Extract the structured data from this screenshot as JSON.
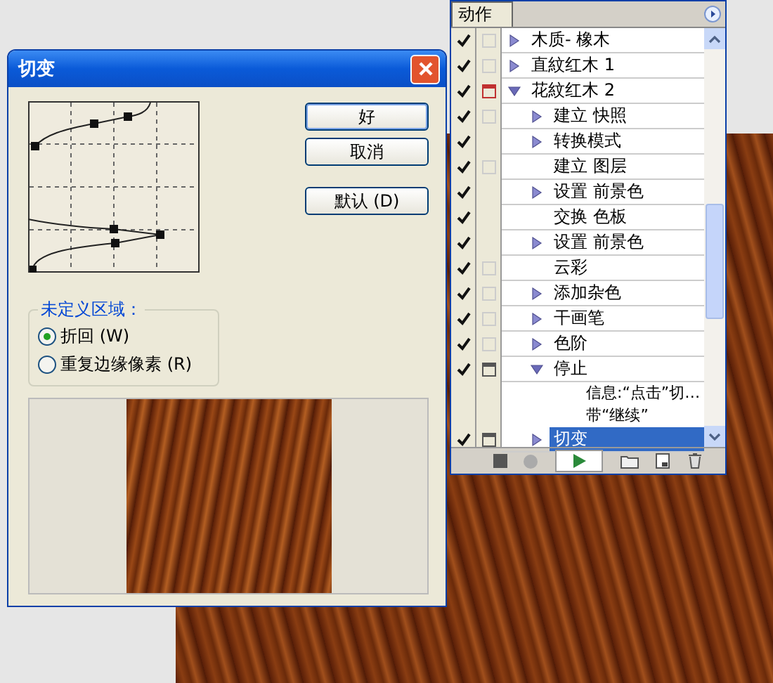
{
  "dialog": {
    "title": "切变",
    "buttons": [
      {
        "label": "好",
        "default": true
      },
      {
        "label": "取消",
        "default": false
      },
      {
        "label": "默认 (D)",
        "default": false
      }
    ],
    "undefined_area": {
      "title": "未定义区域：",
      "options": [
        {
          "label": "折回 (W)",
          "selected": true
        },
        {
          "label": "重复边缘像素 (R)",
          "selected": false
        }
      ]
    }
  },
  "actions_panel": {
    "tab": "动作",
    "items": [
      {
        "label": "木质- 橡木",
        "checked": true,
        "dialog_on": false,
        "dialog_partial": false,
        "expanded": false,
        "selected": false
      },
      {
        "label": "直紋红木 1",
        "checked": true,
        "dialog_on": false,
        "dialog_partial": false,
        "expanded": false,
        "selected": false
      },
      {
        "label": "花紋红木 2",
        "checked": true,
        "dialog_on": false,
        "dialog_partial": true,
        "expanded": true,
        "selected": false,
        "children": [
          {
            "label": "建立 快照",
            "checked": true,
            "dialog_on": false,
            "dialog_partial": false,
            "expanded": false,
            "selected": false
          },
          {
            "label": "转换模式",
            "checked": true,
            "expanded": false,
            "selected": false
          },
          {
            "label": "建立 图层",
            "checked": true,
            "dialog_on": false,
            "dialog_partial": false,
            "selected": false
          },
          {
            "label": "设置 前景色",
            "checked": true,
            "expanded": false,
            "selected": false
          },
          {
            "label": "交换 色板",
            "checked": true,
            "selected": false
          },
          {
            "label": "设置 前景色",
            "checked": true,
            "expanded": false,
            "selected": false
          },
          {
            "label": "云彩",
            "checked": true,
            "dialog_on": false,
            "dialog_partial": false,
            "selected": false
          },
          {
            "label": "添加杂色",
            "checked": true,
            "dialog_on": false,
            "dialog_partial": false,
            "expanded": false,
            "selected": false
          },
          {
            "label": "干画笔",
            "checked": true,
            "dialog_on": false,
            "dialog_partial": false,
            "expanded": false,
            "selected": false
          },
          {
            "label": "色阶",
            "checked": true,
            "dialog_on": false,
            "dialog_partial": false,
            "expanded": false,
            "selected": false
          },
          {
            "label": "停止",
            "checked": true,
            "dialog_on": true,
            "dialog_partial": false,
            "expanded": true,
            "selected": false,
            "details": [
              "信息:“点击”切…",
              "带“继续”"
            ]
          },
          {
            "label": "切变",
            "checked": true,
            "dialog_on": true,
            "dialog_partial": false,
            "expanded": false,
            "selected": true
          }
        ]
      }
    ]
  }
}
